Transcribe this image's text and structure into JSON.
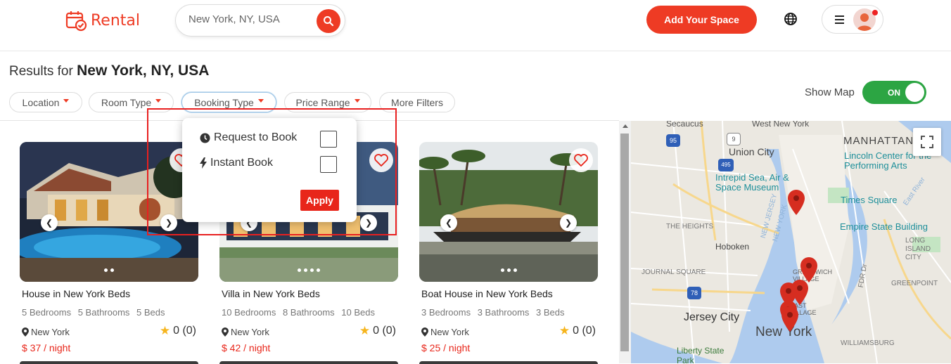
{
  "header": {
    "logo_text": "Rental",
    "search_placeholder": "New York, NY, USA",
    "add_space_label": "Add Your Space",
    "brand_color": "#ee3b24"
  },
  "results": {
    "prefix": "Results for",
    "location": "New York, NY, USA"
  },
  "filters": [
    {
      "label": "Location"
    },
    {
      "label": "Room Type"
    },
    {
      "label": "Booking Type"
    },
    {
      "label": "Price Range"
    },
    {
      "label": "More Filters"
    }
  ],
  "map_toggle": {
    "label": "Show Map",
    "state": "ON"
  },
  "booking_dropdown": {
    "options": [
      {
        "label": "Request to Book",
        "icon": "clock-icon"
      },
      {
        "label": "Instant Book",
        "icon": "lightning-icon"
      }
    ],
    "apply_label": "Apply"
  },
  "listings": [
    {
      "title": "House in New York Beds",
      "bedrooms": "5 Bedrooms",
      "bathrooms": "5 Bathrooms",
      "beds": "5 Beds",
      "location": "New York",
      "rating": "0 (0)",
      "price": "$ 37 / night"
    },
    {
      "title": "Villa in New York Beds",
      "bedrooms": "10 Bedrooms",
      "bathrooms": "8 Bathrooms",
      "beds": "10 Beds",
      "location": "New York",
      "rating": "0 (0)",
      "price": "$ 42 / night"
    },
    {
      "title": "Boat House in New York Beds",
      "bedrooms": "3 Bedrooms",
      "bathrooms": "3 Bathrooms",
      "beds": "3 Beds",
      "location": "New York",
      "rating": "0 (0)",
      "price": "$ 25 / night"
    }
  ],
  "map": {
    "labels": {
      "secaucus": "Secaucus",
      "west_new_york": "West New York",
      "manhattan": "MANHATTAN",
      "union_city": "Union City",
      "lincoln_center": "Lincoln Center for the Performing Arts",
      "intrepid": "Intrepid Sea, Air & Space Museum",
      "times_square": "Times Square",
      "the_heights": "THE HEIGHTS",
      "empire_state": "Empire State Building",
      "hoboken": "Hoboken",
      "long_island_city": "LONG ISLAND CITY",
      "journal_square": "JOURNAL SQUARE",
      "greenpoint": "GREENPOINT",
      "jersey_city": "Jersey City",
      "new_york": "New York",
      "williamsburg": "WILLIAMSBURG",
      "liberty_state_park": "Liberty State Park",
      "new_jersey": "NEW JERSEY",
      "new_york_state": "NEW YORK",
      "east_river": "East River",
      "fdr_dr": "FDR Dr",
      "greenwich_village": "GREENWICH VILLAGE",
      "east_village": "EAST VILLAGE",
      "hwy_9": "9",
      "hwy_95": "95",
      "hwy_495": "495",
      "hwy_78": "78"
    }
  }
}
